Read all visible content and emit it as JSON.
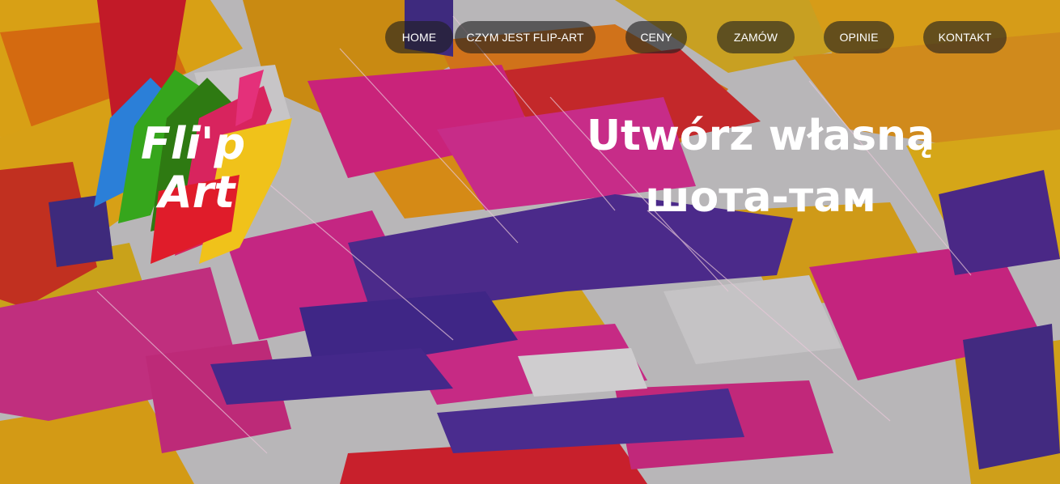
{
  "nav": {
    "home": "HOME",
    "about": "CZYM JEST FLIP-ART",
    "prices": "CENY",
    "order": "ZAMÓW",
    "reviews": "OPINIE",
    "contact": "KONTAKT"
  },
  "logo": {
    "line1": "Fli'p",
    "line2": "Art"
  },
  "hero": {
    "line1": "Utwórz własną",
    "line2": "шота-там"
  }
}
